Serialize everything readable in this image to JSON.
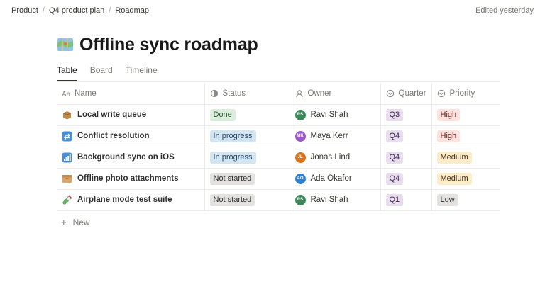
{
  "breadcrumb": [
    "Product",
    "Q4 product plan",
    "Roadmap"
  ],
  "edited": "Edited yesterday",
  "page": {
    "icon": "map-icon",
    "title": "Offline sync roadmap"
  },
  "tabs": [
    {
      "label": "Table",
      "active": true
    },
    {
      "label": "Board",
      "active": false
    },
    {
      "label": "Timeline",
      "active": false
    }
  ],
  "columns": {
    "name": {
      "label": "Name",
      "icon": "text-property-icon"
    },
    "status": {
      "label": "Status",
      "icon": "status-icon"
    },
    "owner": {
      "label": "Owner",
      "icon": "person-icon"
    },
    "quarter": {
      "label": "Quarter",
      "icon": "select-icon"
    },
    "priority": {
      "label": "Priority",
      "icon": "select-icon"
    }
  },
  "rows": [
    {
      "icon": "package-icon",
      "name": "Local write queue",
      "status": "Done",
      "owner": "Ravi Shah",
      "initials": "RS",
      "avatar_color": "#3c8a5a",
      "quarter": "Q3",
      "priority": "High"
    },
    {
      "icon": "sync-arrows-icon",
      "name": "Conflict resolution",
      "status": "In progress",
      "owner": "Maya Kerr",
      "initials": "MK",
      "avatar_color": "#9b59c5",
      "quarter": "Q4",
      "priority": "High"
    },
    {
      "icon": "signal-bars-icon",
      "name": "Background sync on iOS",
      "status": "In progress",
      "owner": "Jonas Lind",
      "initials": "JL",
      "avatar_color": "#d9731f",
      "quarter": "Q4",
      "priority": "Medium"
    },
    {
      "icon": "card-box-icon",
      "name": "Offline photo attachments",
      "status": "Not started",
      "owner": "Ada Okafor",
      "initials": "AO",
      "avatar_color": "#2f80d1",
      "quarter": "Q4",
      "priority": "Medium"
    },
    {
      "icon": "test-tube-icon",
      "name": "Airplane mode test suite",
      "status": "Not started",
      "owner": "Ravi Shah",
      "initials": "RS",
      "avatar_color": "#3c8a5a",
      "quarter": "Q1",
      "priority": "Low"
    }
  ],
  "new_label": "New",
  "colors": {
    "status": {
      "Done": {
        "bg": "#dbeddb",
        "fg": "#2b593f"
      },
      "In progress": {
        "bg": "#d3e5ef",
        "fg": "#28456c"
      },
      "Not started": {
        "bg": "#e3e2e0",
        "fg": "#32302c"
      }
    },
    "quarter": {
      "bg": "#e8deee",
      "fg": "#412454"
    },
    "priority": {
      "High": {
        "bg": "#ffe2dd",
        "fg": "#5d1715"
      },
      "Medium": {
        "bg": "#fdecc8",
        "fg": "#402c1b"
      },
      "Low": {
        "bg": "#e3e2e0",
        "fg": "#32302c"
      }
    }
  }
}
